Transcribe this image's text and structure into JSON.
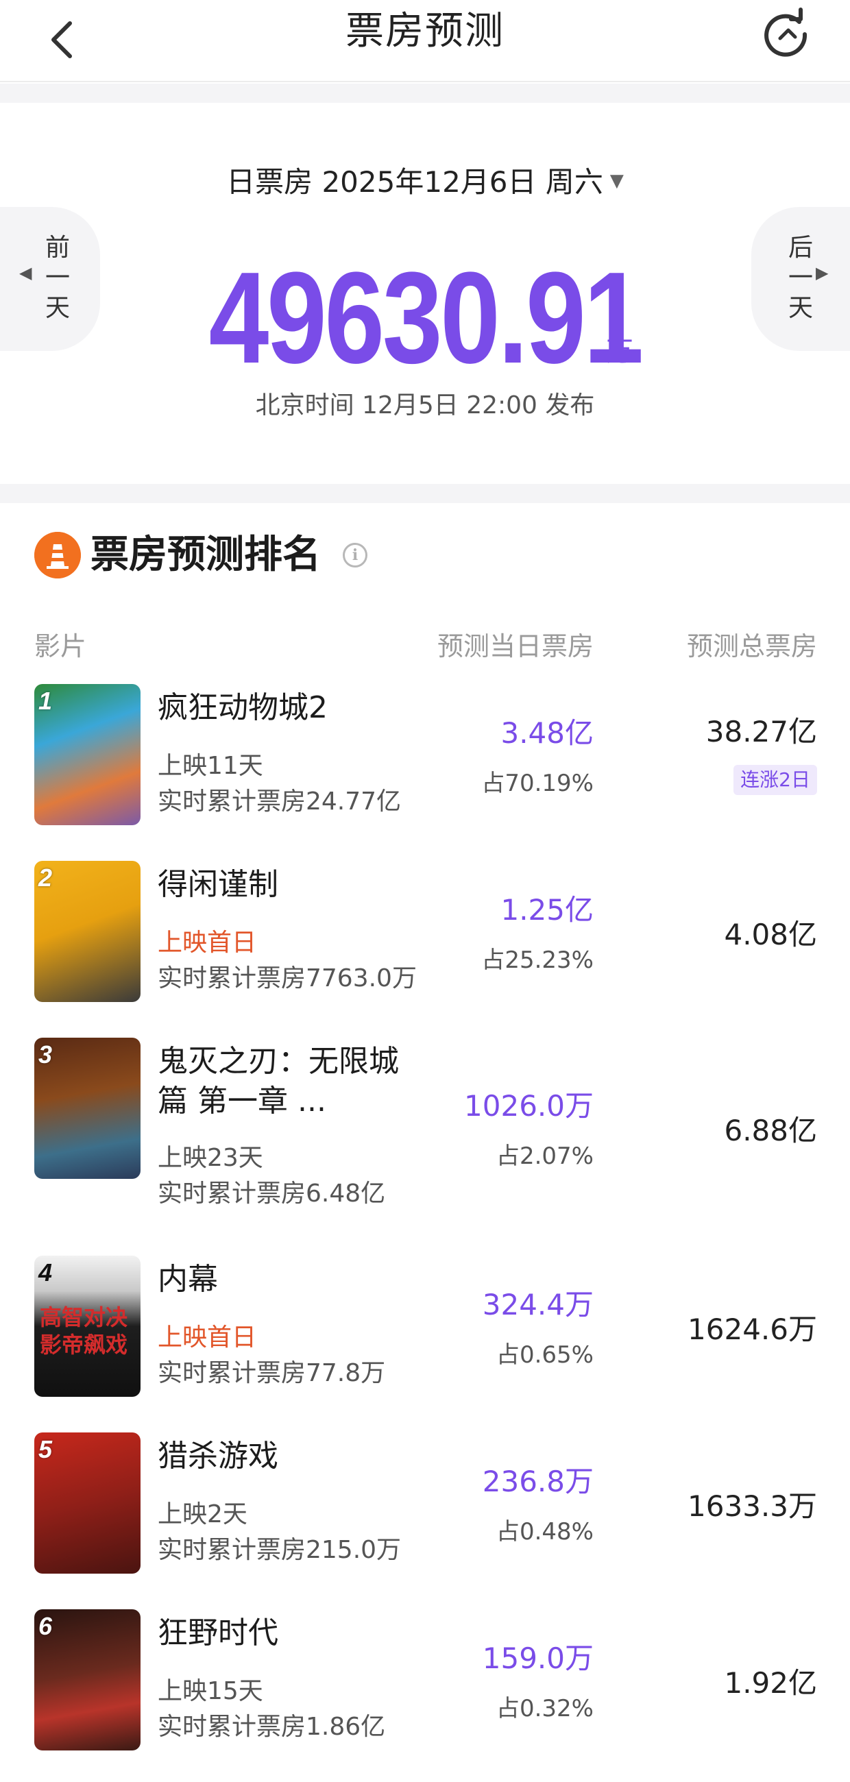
{
  "header": {
    "title": "票房预测",
    "back_icon": "back-arrow-icon",
    "refresh_icon": "refresh-icon"
  },
  "hero": {
    "date_label": "日票房 2025年12月6日 周六",
    "prev_label": [
      "前",
      "一",
      "天"
    ],
    "next_label": [
      "后",
      "一",
      "天"
    ],
    "total_value": "49630.91",
    "total_unit": "万",
    "publish_time": "北京时间 12月5日 22:00 发布",
    "accent_color": "#7a4ce8"
  },
  "ranking": {
    "title": "票房预测排名",
    "columns": {
      "film": "影片",
      "day": "预测当日票房",
      "total": "预测总票房"
    },
    "rows": [
      {
        "rank": "1",
        "name": "疯狂动物城2",
        "status": "上映11天",
        "cumulative": "实时累计票房24.77亿",
        "day_box": "3.48亿",
        "share": "占70.19%",
        "total": "38.27亿",
        "badge": "连涨2日"
      },
      {
        "rank": "2",
        "name": "得闲谨制",
        "status": "上映首日",
        "cumulative": "实时累计票房7763.0万",
        "day_box": "1.25亿",
        "share": "占25.23%",
        "total": "4.08亿"
      },
      {
        "rank": "3",
        "name": "鬼灭之刃：无限城篇 第一章 ...",
        "status": "上映23天",
        "cumulative": "实时累计票房6.48亿",
        "day_box": "1026.0万",
        "share": "占2.07%",
        "total": "6.88亿"
      },
      {
        "rank": "4",
        "name": "内幕",
        "status": "上映首日",
        "cumulative": "实时累计票房77.8万",
        "day_box": "324.4万",
        "share": "占0.65%",
        "total": "1624.6万",
        "poster_text": "高智对决 影帝飙戏"
      },
      {
        "rank": "5",
        "name": "猎杀游戏",
        "status": "上映2天",
        "cumulative": "实时累计票房215.0万",
        "day_box": "236.8万",
        "share": "占0.48%",
        "total": "1633.3万"
      },
      {
        "rank": "6",
        "name": "狂野时代",
        "status": "上映15天",
        "cumulative": "实时累计票房1.86亿",
        "day_box": "159.0万",
        "share": "占0.32%",
        "total": "1.92亿"
      }
    ]
  }
}
